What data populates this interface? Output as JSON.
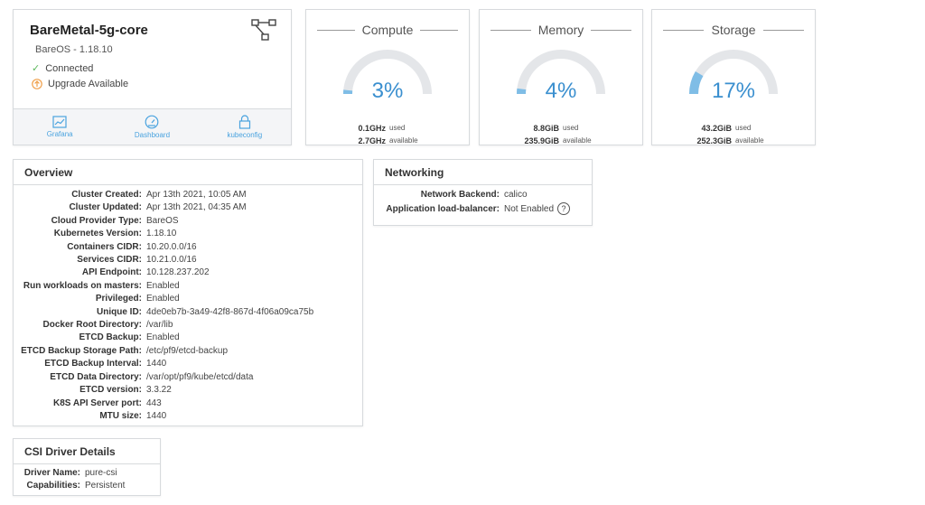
{
  "cluster": {
    "name": "BareMetal-5g-core",
    "os_version": "BareOS - 1.18.10",
    "status": "Connected",
    "upgrade": "Upgrade Available",
    "actions": [
      {
        "label": "Grafana"
      },
      {
        "label": "Dashboard"
      },
      {
        "label": "kubeconfig"
      }
    ]
  },
  "gauges": [
    {
      "title": "Compute",
      "percent": 3,
      "percent_label": "3%",
      "used_value": "0.1GHz",
      "used_label": "used",
      "available_value": "2.7GHz",
      "available_label": "available"
    },
    {
      "title": "Memory",
      "percent": 4,
      "percent_label": "4%",
      "used_value": "8.8GiB",
      "used_label": "used",
      "available_value": "235.9GiB",
      "available_label": "available"
    },
    {
      "title": "Storage",
      "percent": 17,
      "percent_label": "17%",
      "used_value": "43.2GiB",
      "used_label": "used",
      "available_value": "252.3GiB",
      "available_label": "available"
    }
  ],
  "overview": {
    "title": "Overview",
    "rows": [
      {
        "key": "Cluster Created:",
        "value": "Apr 13th 2021, 10:05 AM"
      },
      {
        "key": "Cluster Updated:",
        "value": "Apr 13th 2021, 04:35 AM"
      },
      {
        "key": "Cloud Provider Type:",
        "value": "BareOS"
      },
      {
        "key": "Kubernetes Version:",
        "value": "1.18.10"
      },
      {
        "key": "Containers CIDR:",
        "value": "10.20.0.0/16"
      },
      {
        "key": "Services CIDR:",
        "value": "10.21.0.0/16"
      },
      {
        "key": "API Endpoint:",
        "value": "10.128.237.202"
      },
      {
        "key": "Run workloads on masters:",
        "value": "Enabled"
      },
      {
        "key": "Privileged:",
        "value": "Enabled"
      },
      {
        "key": "Unique ID:",
        "value": "4de0eb7b-3a49-42f8-867d-4f06a09ca75b"
      },
      {
        "key": "Docker Root Directory:",
        "value": "/var/lib"
      },
      {
        "key": "ETCD Backup:",
        "value": "Enabled"
      },
      {
        "key": "ETCD Backup Storage Path:",
        "value": "/etc/pf9/etcd-backup"
      },
      {
        "key": "ETCD Backup Interval:",
        "value": "1440"
      },
      {
        "key": "ETCD Data Directory:",
        "value": "/var/opt/pf9/kube/etcd/data"
      },
      {
        "key": "ETCD version:",
        "value": "3.3.22"
      },
      {
        "key": "K8S API Server port:",
        "value": "443"
      },
      {
        "key": "MTU size:",
        "value": "1440"
      }
    ]
  },
  "networking": {
    "title": "Networking",
    "rows": [
      {
        "key": "Network Backend:",
        "value": "calico"
      },
      {
        "key": "Application load-balancer:",
        "value": "Not Enabled"
      }
    ],
    "help_glyph": "?"
  },
  "csi": {
    "title": "CSI Driver Details",
    "rows": [
      {
        "key": "Driver Name:",
        "value": "pure-csi"
      },
      {
        "key": "Capabilities:",
        "value": "Persistent"
      }
    ]
  },
  "colors": {
    "accent": "#4aa3df",
    "gauge_fill": "#7fbde6",
    "gauge_track": "#e4e6e9",
    "connected": "#5cb85c",
    "upgrade": "#f0a04b"
  }
}
